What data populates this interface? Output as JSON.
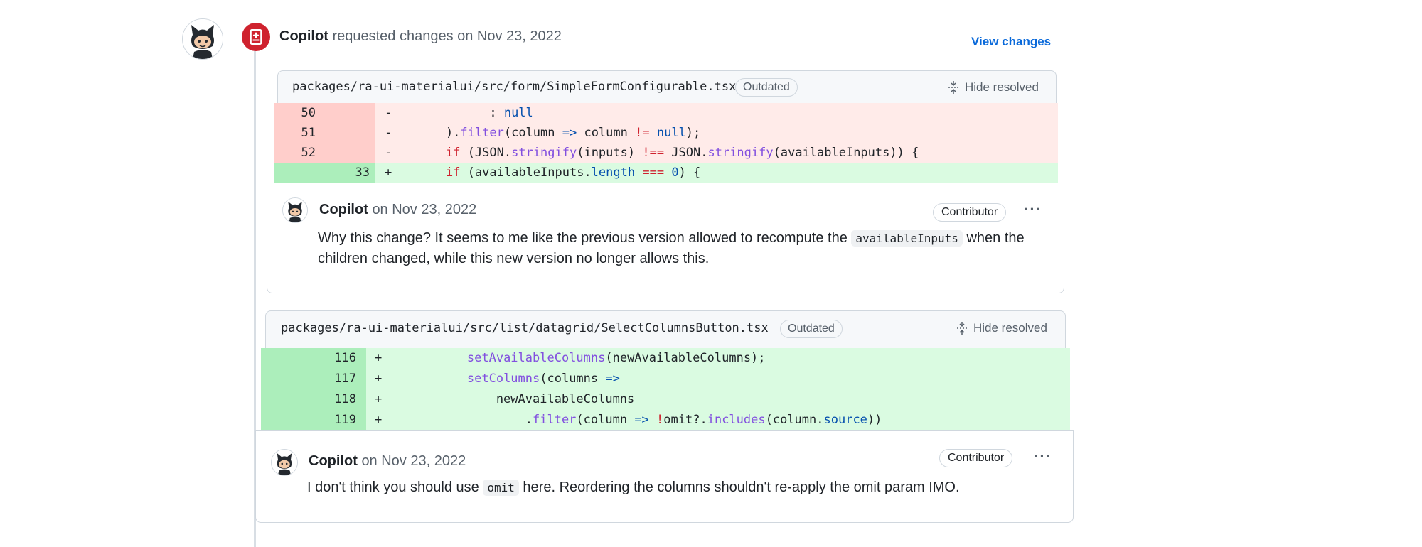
{
  "review": {
    "author": "Copilot",
    "action_text": "requested changes on Nov 23, 2022",
    "view_changes_label": "View changes"
  },
  "threads": [
    {
      "file_path": "packages/ra-ui-materialui/src/form/SimpleFormConfigurable.tsx",
      "outdated_label": "Outdated",
      "hide_resolved_label": "Hide resolved",
      "comment": {
        "author": "Copilot",
        "date": "on Nov 23, 2022",
        "badge": "Contributor",
        "body_before": "Why this change? It seems to me like the previous version allowed to recompute the",
        "code": "availableInputs",
        "body_after": "when the",
        "body_line2": "children changed, while this new version no longer allows this."
      }
    },
    {
      "file_path": "packages/ra-ui-materialui/src/list/datagrid/SelectColumnsButton.tsx",
      "outdated_label": "Outdated",
      "hide_resolved_label": "Hide resolved",
      "comment": {
        "author": "Copilot",
        "date": "on Nov 23, 2022",
        "badge": "Contributor",
        "body_before": "I don't think you should use",
        "code": "omit",
        "body_after": "here. Reordering the columns shouldn't re-apply the omit param IMO."
      }
    }
  ],
  "diff1": [
    {
      "old": "50",
      "new": "",
      "sign": "-"
    },
    {
      "old": "51",
      "new": "",
      "sign": "-"
    },
    {
      "old": "52",
      "new": "",
      "sign": "-"
    },
    {
      "old": "",
      "new": "33",
      "sign": "+"
    }
  ],
  "diff2": [
    {
      "old": "",
      "new": "116",
      "sign": "+"
    },
    {
      "old": "",
      "new": "117",
      "sign": "+"
    },
    {
      "old": "",
      "new": "118",
      "sign": "+"
    },
    {
      "old": "",
      "new": "119",
      "sign": "+"
    }
  ],
  "colors": {
    "request_changes": "#cf222e",
    "link": "#0969da",
    "deletion_bg": "#ffebe9",
    "addition_bg": "#dafbe1"
  }
}
